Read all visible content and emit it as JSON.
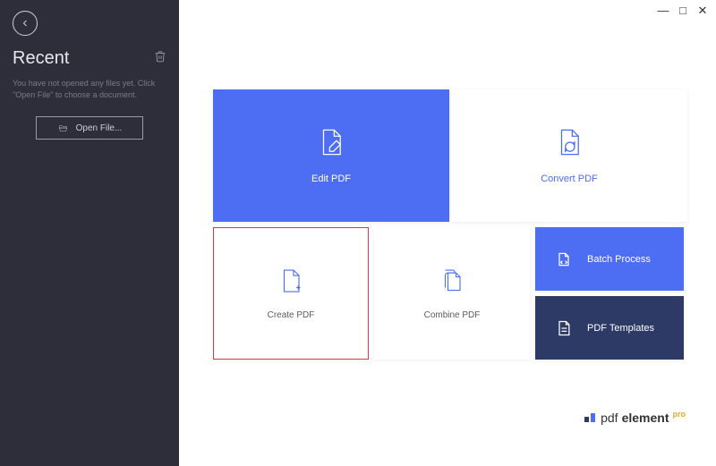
{
  "window": {
    "min": "—",
    "max": "□",
    "close": "✕"
  },
  "sidebar": {
    "title": "Recent",
    "hint": "You have not opened any files yet. Click \"Open File\" to choose a document.",
    "open_label": "Open File..."
  },
  "cards": {
    "edit": "Edit PDF",
    "convert": "Convert PDF",
    "create": "Create PDF",
    "combine": "Combine PDF",
    "batch": "Batch Process",
    "templates": "PDF Templates"
  },
  "brand": {
    "part1": "pdf",
    "part2": "element",
    "tag": "pro"
  }
}
